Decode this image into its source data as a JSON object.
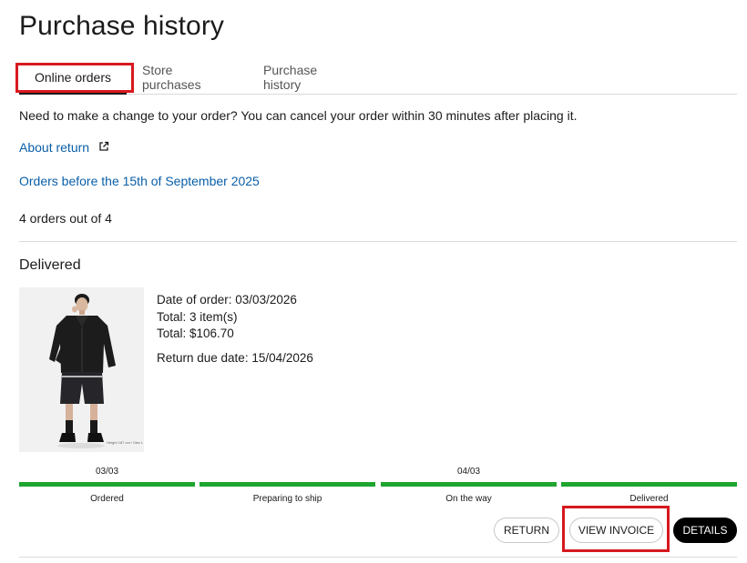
{
  "page": {
    "title": "Purchase history"
  },
  "tabs": [
    {
      "label": "Online orders",
      "active": true
    },
    {
      "label": "Store purchases",
      "active": false
    },
    {
      "label": "Purchase history",
      "active": false
    }
  ],
  "notice": "Need to make a change to your order? You can cancel your order within 30 minutes after placing it.",
  "links": {
    "about_return": "About return",
    "about_return_icon": "external-link-icon",
    "orders_before": "Orders before the 15th of September 2025"
  },
  "orders_count": "4 orders out of 4",
  "order": {
    "status": "Delivered",
    "image_caption": "Height 187 cm / Size L",
    "date_of_order": "Date of order: 03/03/2026",
    "total_items": "Total: 3 item(s)",
    "total_price": "Total: $106.70",
    "return_due": "Return due date: 15/04/2026",
    "progress": [
      {
        "date": "03/03",
        "label": "Ordered"
      },
      {
        "date": "",
        "label": "Preparing to ship"
      },
      {
        "date": "04/03",
        "label": "On the way"
      },
      {
        "date": "",
        "label": "Delivered"
      }
    ],
    "buttons": {
      "return": "RETURN",
      "view_invoice": "VIEW INVOICE",
      "details": "DETAILS"
    }
  },
  "colors": {
    "link": "#0a5fa8",
    "progress": "#1ea52e",
    "highlight": "#d71920",
    "primary_button": "#000000"
  }
}
